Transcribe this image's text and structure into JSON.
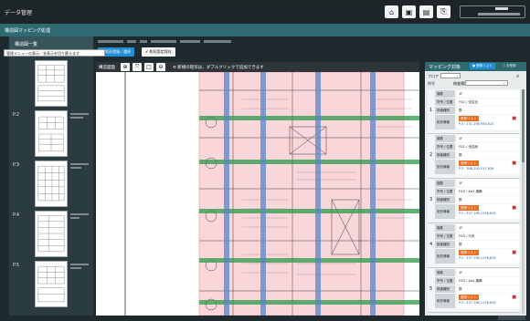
{
  "app": {
    "title": "データ管理"
  },
  "header": {
    "icons": [
      "home-icon",
      "folder-icon",
      "image-icon",
      "logout-icon"
    ],
    "user_name": "",
    "user_email": ""
  },
  "page": {
    "title": "構造図マッピング処理"
  },
  "left_panel": {
    "title": "構造図一覧",
    "tooltip": "管理メニューの表示／非表示を切り替えます",
    "pages": [
      {
        "label": ""
      },
      {
        "label": "P.2"
      },
      {
        "label": "P.3"
      },
      {
        "label": "P.4"
      },
      {
        "label": "P.5"
      }
    ]
  },
  "actions": {
    "select_rect_label": "矩形登録／選択",
    "save_label": "矩形設定保存"
  },
  "drawing": {
    "toolbar_label": "構造図面",
    "hint": "新規の矩形は、ダブルクリックで追加できます"
  },
  "mapping": {
    "title": "マッピング対象",
    "toggle_on": "登録リスト",
    "toggle_off": "未登録",
    "filter": {
      "floor_label": "フロア",
      "number_label": "符号",
      "type_label": "検査種別",
      "type_value": "検査種別"
    },
    "entries": [
      {
        "num": "1",
        "floor": "1F",
        "code": "FG1 / 全柱全",
        "type": "筋",
        "status": "登録リスト",
        "coords": "P.3 : 231,198,958,623"
      },
      {
        "num": "2",
        "floor": "1F",
        "code": "FG2 / 全柱面",
        "type": "筋",
        "status": "登録リスト",
        "coords": "P.3 : 368,200,537,626"
      },
      {
        "num": "3",
        "floor": "1F",
        "code": "FG3 / XA3 通構",
        "type": "筋",
        "status": "登録リスト",
        "coords": "P.3 : 537,198,1136,626"
      },
      {
        "num": "4",
        "floor": "1F",
        "code": "FG3 / 中央",
        "type": "筋",
        "status": "登録リスト",
        "coords": "P.3 : 537,198,1136,626"
      },
      {
        "num": "5",
        "floor": "1F",
        "code": "FG3 / XA4 通構",
        "type": "筋",
        "status": "登録リスト",
        "coords": "P.3 : 537,198,1136,626"
      }
    ],
    "labels": {
      "floor": "階数",
      "code": "符号 / 位置",
      "type": "検査種別",
      "registration": "矩形情報"
    }
  },
  "colors": {
    "accent": "#1f8fd8",
    "header": "#2f6a72",
    "status": "#ec6a1c",
    "highlight": "#f8d6da"
  }
}
